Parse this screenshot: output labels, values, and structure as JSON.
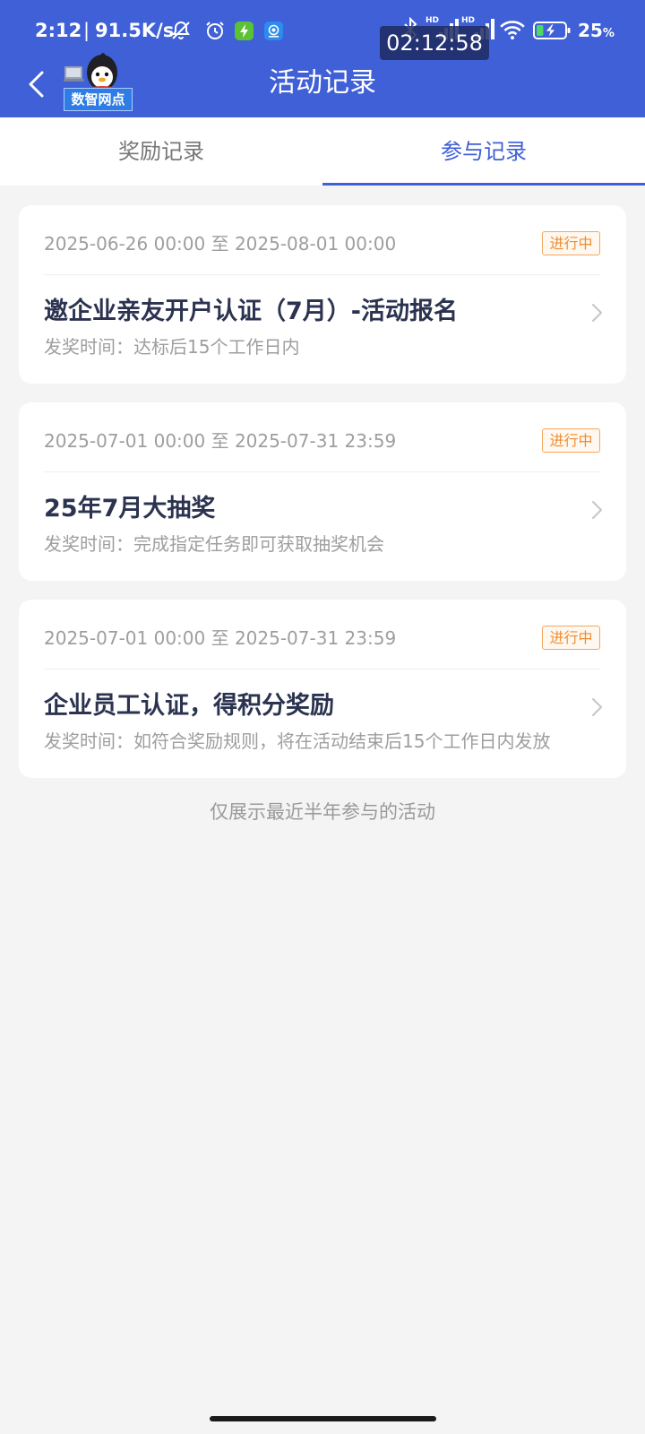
{
  "status_bar": {
    "time": "2:12",
    "separator": "|",
    "net_speed": "91.5K/s",
    "left_icons": [
      "mute-notification-icon",
      "alarm-clock-icon",
      "battery-saver-icon",
      "app-notification-icon"
    ],
    "right_icons": [
      "bluetooth-icon",
      "signal-icon",
      "signal-icon",
      "wifi-icon",
      "battery-charging-icon"
    ],
    "signal_labels": [
      "HD",
      "HD"
    ],
    "battery_percent": "25",
    "battery_unit": "%",
    "battery_level": 0.25
  },
  "screen_recorder": {
    "elapsed": "02:12:58"
  },
  "header": {
    "back_icon": "chevron-left-icon",
    "logo_icon": "penguin-mascot-icon",
    "logo_label": "数智网点",
    "title": "活动记录"
  },
  "tabs": [
    {
      "label": "奖励记录",
      "active": false
    },
    {
      "label": "参与记录",
      "active": true
    }
  ],
  "records": [
    {
      "period": "2025-06-26 00:00 至 2025-08-01 00:00",
      "status": "进行中",
      "title": "邀企业亲友开户认证（7月）-活动报名",
      "reward_time": "发奖时间：达标后15个工作日内"
    },
    {
      "period": "2025-07-01 00:00 至 2025-07-31 23:59",
      "status": "进行中",
      "title": "25年7月大抽奖",
      "reward_time": "发奖时间：完成指定任务即可获取抽奖机会"
    },
    {
      "period": "2025-07-01 00:00 至 2025-07-31 23:59",
      "status": "进行中",
      "title": "企业员工认证，得积分奖励",
      "reward_time": "发奖时间：如符合奖励规则，将在活动结束后15个工作日内发放"
    }
  ],
  "footer_note": "仅展示最近半年参与的活动",
  "colors": {
    "primary": "#3F60D6",
    "status_in_progress": "#F08C2E",
    "background": "#F4F4F4",
    "battery_fill": "#4CD964"
  }
}
